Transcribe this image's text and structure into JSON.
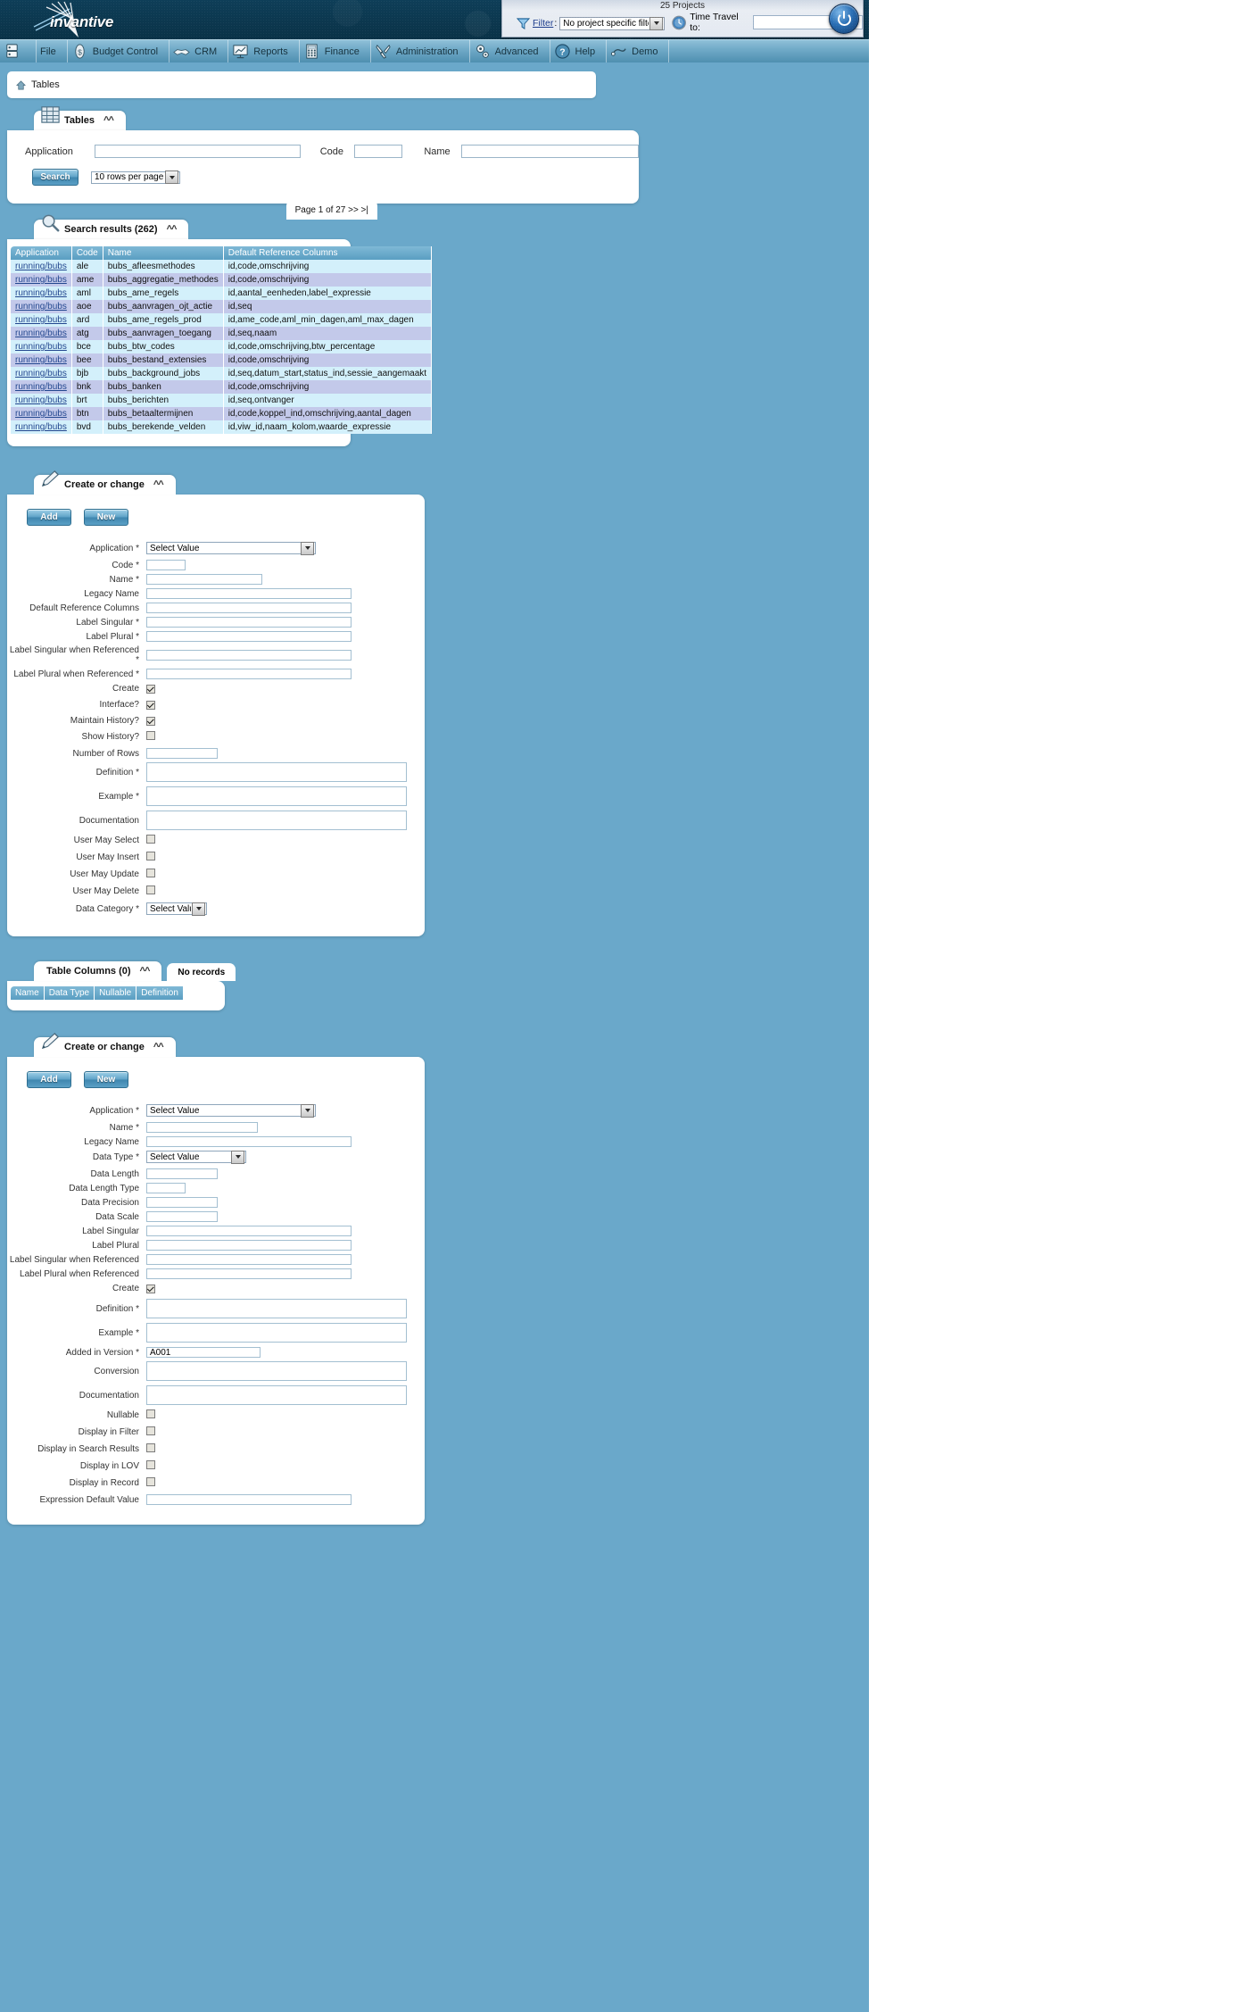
{
  "app": {
    "logo_text": "invantive",
    "projects_label": "25 Projects"
  },
  "topbar": {
    "funnel_icon": "funnel-icon",
    "filter_label": "Filter",
    "filter_colon": ":",
    "filter_value": "No project specific filter",
    "clock_icon": "clock-icon",
    "time_travel_label": "Time Travel to:",
    "time_travel_value": "",
    "power_icon": "power-icon"
  },
  "menu": {
    "items": [
      {
        "label": "",
        "icon": "server-icon"
      },
      {
        "label": "File",
        "icon": "file-icon"
      },
      {
        "label": "Budget Control",
        "icon": "money-icon"
      },
      {
        "label": "CRM",
        "icon": "handshake-icon"
      },
      {
        "label": "Reports",
        "icon": "presentation-chart-icon"
      },
      {
        "label": "Finance",
        "icon": "calculator-icon"
      },
      {
        "label": "Administration",
        "icon": "tools-icon"
      },
      {
        "label": "Advanced",
        "icon": "gears-icon"
      },
      {
        "label": "Help",
        "icon": "question-circle-icon"
      },
      {
        "label": "Demo",
        "icon": "plug-icon"
      }
    ]
  },
  "breadcrumb": {
    "home_icon": "home-icon",
    "text": "Tables"
  },
  "search_panel": {
    "tab_label": "Tables",
    "tab_icon": "grid-table-icon",
    "collapse_icon": "chevron-up-icon",
    "fields": {
      "application_label": "Application",
      "application_value": "",
      "code_label": "Code",
      "code_value": "",
      "name_label": "Name",
      "name_value": ""
    },
    "search_button": "Search",
    "rows_per_page": "10 rows per page"
  },
  "results_panel": {
    "tab_label": "Search results (262)",
    "tab_icon": "magnifier-icon",
    "collapse_icon": "chevron-up-icon",
    "pager": "Page 1 of 27  >>  >|",
    "columns": [
      "Application",
      "Code",
      "Name",
      "Default Reference Columns"
    ],
    "rows": [
      [
        "running/bubs",
        "ale",
        "bubs_afleesmethodes",
        "id,code,omschrijving"
      ],
      [
        "running/bubs",
        "ame",
        "bubs_aggregatie_methodes",
        "id,code,omschrijving"
      ],
      [
        "running/bubs",
        "aml",
        "bubs_ame_regels",
        "id,aantal_eenheden,label_expressie"
      ],
      [
        "running/bubs",
        "aoe",
        "bubs_aanvragen_ojt_actie",
        "id,seq"
      ],
      [
        "running/bubs",
        "ard",
        "bubs_ame_regels_prod",
        "id,ame_code,aml_min_dagen,aml_max_dagen"
      ],
      [
        "running/bubs",
        "atg",
        "bubs_aanvragen_toegang",
        "id,seq,naam"
      ],
      [
        "running/bubs",
        "bce",
        "bubs_btw_codes",
        "id,code,omschrijving,btw_percentage"
      ],
      [
        "running/bubs",
        "bee",
        "bubs_bestand_extensies",
        "id,code,omschrijving"
      ],
      [
        "running/bubs",
        "bjb",
        "bubs_background_jobs",
        "id,seq,datum_start,status_ind,sessie_aangemaakt"
      ],
      [
        "running/bubs",
        "bnk",
        "bubs_banken",
        "id,code,omschrijving"
      ],
      [
        "running/bubs",
        "brt",
        "bubs_berichten",
        "id,seq,ontvanger"
      ],
      [
        "running/bubs",
        "btn",
        "bubs_betaaltermijnen",
        "id,code,koppel_ind,omschrijving,aantal_dagen"
      ],
      [
        "running/bubs",
        "bvd",
        "bubs_berekende_velden",
        "id,viw_id,naam_kolom,waarde_expressie"
      ]
    ]
  },
  "create_table_panel": {
    "tab_label": "Create or change",
    "tab_icon": "pencil-icon",
    "collapse_icon": "chevron-up-icon",
    "add_button": "Add",
    "new_button": "New",
    "fields": [
      {
        "label": "Application *",
        "type": "select",
        "value": "Select Value"
      },
      {
        "label": "Code *",
        "type": "text-xs",
        "value": ""
      },
      {
        "label": "Name *",
        "type": "text-sm",
        "value": ""
      },
      {
        "label": "Legacy Name",
        "type": "text-lg",
        "value": ""
      },
      {
        "label": "Default Reference Columns",
        "type": "text-lg",
        "value": ""
      },
      {
        "label": "Label Singular *",
        "type": "text-lg",
        "value": ""
      },
      {
        "label": "Label Plural *",
        "type": "text-lg",
        "value": ""
      },
      {
        "label": "Label Singular when Referenced *",
        "type": "text-lg",
        "value": ""
      },
      {
        "label": "Label Plural when Referenced *",
        "type": "text-lg",
        "value": ""
      },
      {
        "label": "Create",
        "type": "checkbox",
        "checked": true
      },
      {
        "label": "Interface?",
        "type": "checkbox",
        "checked": true
      },
      {
        "label": "Maintain History?",
        "type": "checkbox",
        "checked": true
      },
      {
        "label": "Show History?",
        "type": "checkbox",
        "checked": false
      },
      {
        "label": "Number of Rows",
        "type": "text-md",
        "value": ""
      },
      {
        "label": "Definition *",
        "type": "textarea",
        "value": ""
      },
      {
        "label": "Example *",
        "type": "textarea",
        "value": ""
      },
      {
        "label": "Documentation",
        "type": "textarea",
        "value": ""
      },
      {
        "label": "User May Select",
        "type": "checkbox",
        "checked": false
      },
      {
        "label": "User May Insert",
        "type": "checkbox",
        "checked": false
      },
      {
        "label": "User May Update",
        "type": "checkbox",
        "checked": false
      },
      {
        "label": "User May Delete",
        "type": "checkbox",
        "checked": false
      },
      {
        "label": "Data Category *",
        "type": "select-sm",
        "value": "Select Value"
      }
    ]
  },
  "table_columns_panel": {
    "tab_label": "Table Columns (0)",
    "collapse_icon": "chevron-up-icon",
    "no_records_label": "No records",
    "columns": [
      "Name",
      "Data Type",
      "Nullable",
      "Definition"
    ]
  },
  "create_column_panel": {
    "tab_label": "Create or change",
    "tab_icon": "pencil-icon",
    "collapse_icon": "chevron-up-icon",
    "add_button": "Add",
    "new_button": "New",
    "fields": [
      {
        "label": "Application *",
        "type": "select",
        "value": "Select Value"
      },
      {
        "label": "Name *",
        "type": "text-sm2",
        "value": ""
      },
      {
        "label": "Legacy Name",
        "type": "text-lg",
        "value": ""
      },
      {
        "label": "Data Type *",
        "type": "select2",
        "value": "Select Value"
      },
      {
        "label": "Data Length",
        "type": "text-md",
        "value": ""
      },
      {
        "label": "Data Length Type",
        "type": "text-xs",
        "value": ""
      },
      {
        "label": "Data Precision",
        "type": "text-md",
        "value": ""
      },
      {
        "label": "Data Scale",
        "type": "text-md",
        "value": ""
      },
      {
        "label": "Label Singular",
        "type": "text-lg",
        "value": ""
      },
      {
        "label": "Label Plural",
        "type": "text-lg",
        "value": ""
      },
      {
        "label": "Label Singular when Referenced",
        "type": "text-lg",
        "value": ""
      },
      {
        "label": "Label Plural when Referenced",
        "type": "text-lg",
        "value": ""
      },
      {
        "label": "Create",
        "type": "checkbox",
        "checked": true
      },
      {
        "label": "Definition *",
        "type": "textarea",
        "value": ""
      },
      {
        "label": "Example *",
        "type": "textarea",
        "value": ""
      },
      {
        "label": "Added in Version *",
        "type": "text-ver",
        "value": "A001"
      },
      {
        "label": "Conversion",
        "type": "textarea",
        "value": ""
      },
      {
        "label": "Documentation",
        "type": "textarea",
        "value": ""
      },
      {
        "label": "Nullable",
        "type": "checkbox",
        "checked": false
      },
      {
        "label": "Display in Filter",
        "type": "checkbox",
        "checked": false
      },
      {
        "label": "Display in Search Results",
        "type": "checkbox",
        "checked": false
      },
      {
        "label": "Display in LOV",
        "type": "checkbox",
        "checked": false
      },
      {
        "label": "Display in Record",
        "type": "checkbox",
        "checked": false
      },
      {
        "label": "Expression Default Value",
        "type": "text-lg",
        "value": ""
      }
    ]
  }
}
